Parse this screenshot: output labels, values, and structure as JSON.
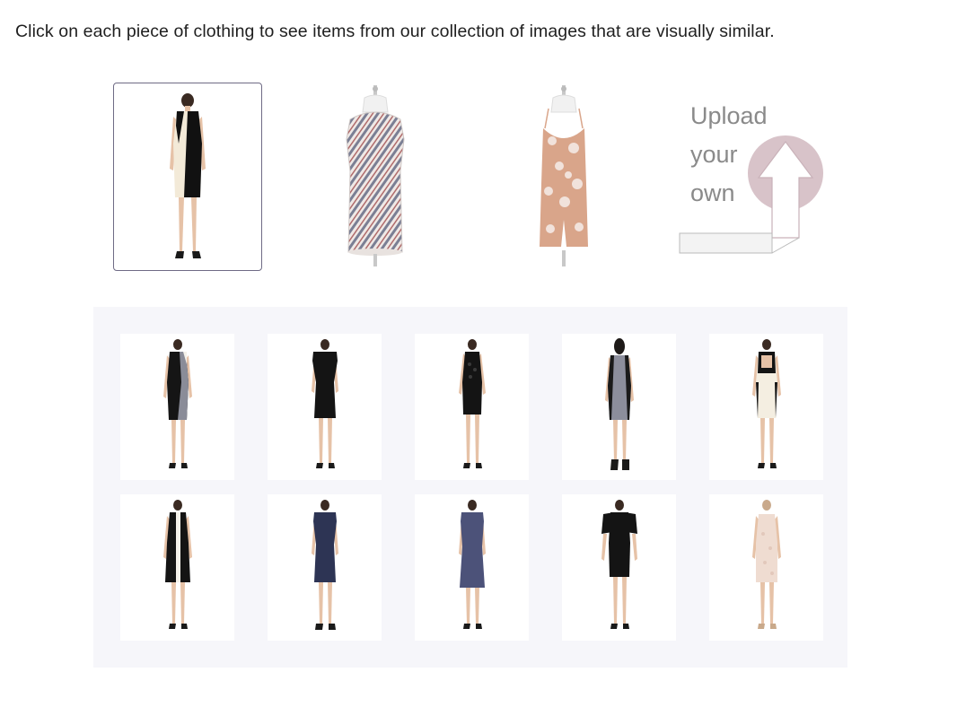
{
  "instruction": "Click on each piece of clothing to see items from our collection of images that are visually similar.",
  "upload": {
    "line1": "Upload",
    "line2": "your",
    "line3": "own",
    "icon": "upload-arrow-icon",
    "accent": "#d8c3c9"
  },
  "queries": [
    {
      "item": "black-and-white-sheath-dress",
      "selected": true
    },
    {
      "item": "striped-sleeveless-top",
      "selected": false
    },
    {
      "item": "floral-romper",
      "selected": false
    }
  ],
  "results": [
    {
      "item": "black-grey-colorblock-dress"
    },
    {
      "item": "black-cap-sleeve-dress"
    },
    {
      "item": "black-lace-dress"
    },
    {
      "item": "grey-panel-dress"
    },
    {
      "item": "black-cream-colorblock-dress"
    },
    {
      "item": "black-white-stripe-dress"
    },
    {
      "item": "navy-sheath-dress"
    },
    {
      "item": "slate-blue-dress"
    },
    {
      "item": "black-short-sleeve-dress"
    },
    {
      "item": "blush-lace-dress"
    }
  ],
  "colors": {
    "selected_border": "#6f6b85",
    "results_bg": "#f6f6fa",
    "skin": "#e6c2a7",
    "shoe": "#1a1a1a"
  }
}
